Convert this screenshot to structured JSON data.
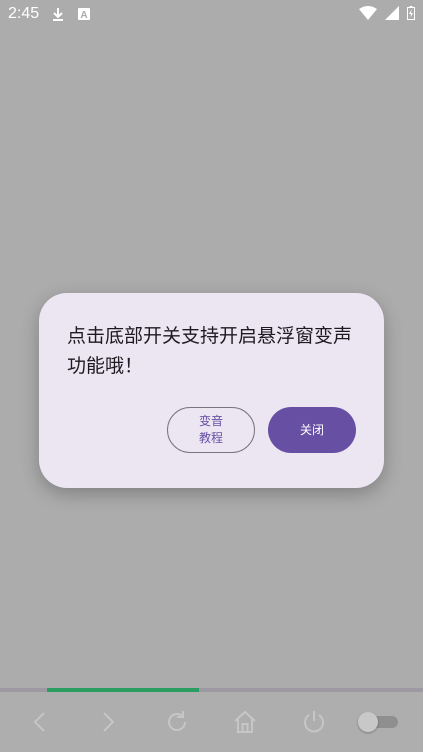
{
  "status_bar": {
    "time": "2:45",
    "icons": [
      "download-icon",
      "keyboard-a-icon",
      "wifi-icon",
      "signal-icon",
      "battery-charging-icon"
    ],
    "notification_letter": "A"
  },
  "dialog": {
    "message": "点击底部开关支持开启悬浮窗变声功能哦！",
    "tutorial_button": "变音\n教程",
    "close_button": "关闭"
  },
  "progress": {
    "fraction": 0.36,
    "color": "#2a9d62"
  },
  "toolbar": {
    "icons": [
      "back-icon",
      "forward-icon",
      "refresh-icon",
      "home-icon",
      "power-icon",
      "toggle-switch"
    ]
  },
  "colors": {
    "scrim": "#acacac",
    "dialog_bg": "#ece6f3",
    "primary": "#6750a4"
  }
}
